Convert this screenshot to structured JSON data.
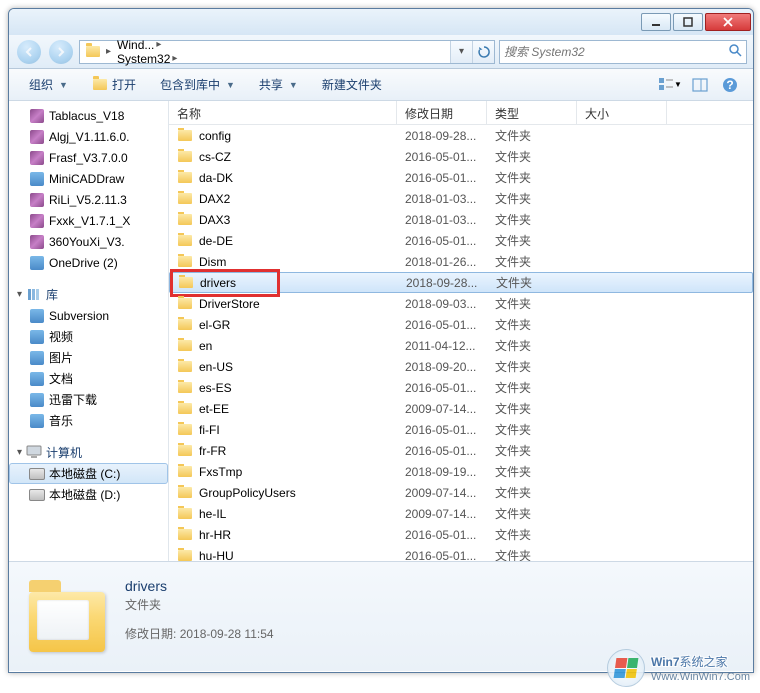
{
  "breadcrumb": {
    "items": [
      "Wind...",
      "System32"
    ]
  },
  "search": {
    "placeholder": "搜索 System32"
  },
  "toolbar": {
    "organize": "组织",
    "open": "打开",
    "include": "包含到库中",
    "share": "共享",
    "newfolder": "新建文件夹"
  },
  "columns": {
    "name": "名称",
    "date": "修改日期",
    "type": "类型",
    "size": "大小"
  },
  "tree": {
    "favorites": [
      {
        "label": "Tablacus_V18",
        "icon": "winrar"
      },
      {
        "label": "Algj_V1.11.6.0.",
        "icon": "winrar"
      },
      {
        "label": "Frasf_V3.7.0.0",
        "icon": "winrar"
      },
      {
        "label": "MiniCADDraw",
        "icon": "app"
      },
      {
        "label": "RiLi_V5.2.11.3",
        "icon": "winrar"
      },
      {
        "label": "Fxxk_V1.7.1_X",
        "icon": "winrar"
      },
      {
        "label": "360YouXi_V3.",
        "icon": "winrar"
      },
      {
        "label": "OneDrive (2)",
        "icon": "app"
      }
    ],
    "library_label": "库",
    "library": [
      {
        "label": "Subversion",
        "icon": "app"
      },
      {
        "label": "视频",
        "icon": "app"
      },
      {
        "label": "图片",
        "icon": "app"
      },
      {
        "label": "文档",
        "icon": "app"
      },
      {
        "label": "迅雷下载",
        "icon": "app"
      },
      {
        "label": "音乐",
        "icon": "app"
      }
    ],
    "computer_label": "计算机",
    "computer": [
      {
        "label": "本地磁盘 (C:)",
        "icon": "drive",
        "selected": true
      },
      {
        "label": "本地磁盘 (D:)",
        "icon": "drive"
      }
    ]
  },
  "files": [
    {
      "name": "config",
      "date": "2018-09-28...",
      "type": "文件夹"
    },
    {
      "name": "cs-CZ",
      "date": "2016-05-01...",
      "type": "文件夹"
    },
    {
      "name": "da-DK",
      "date": "2016-05-01...",
      "type": "文件夹"
    },
    {
      "name": "DAX2",
      "date": "2018-01-03...",
      "type": "文件夹"
    },
    {
      "name": "DAX3",
      "date": "2018-01-03...",
      "type": "文件夹"
    },
    {
      "name": "de-DE",
      "date": "2016-05-01...",
      "type": "文件夹"
    },
    {
      "name": "Dism",
      "date": "2018-01-26...",
      "type": "文件夹"
    },
    {
      "name": "drivers",
      "date": "2018-09-28...",
      "type": "文件夹",
      "selected": true,
      "redbox": true
    },
    {
      "name": "DriverStore",
      "date": "2018-09-03...",
      "type": "文件夹"
    },
    {
      "name": "el-GR",
      "date": "2016-05-01...",
      "type": "文件夹"
    },
    {
      "name": "en",
      "date": "2011-04-12...",
      "type": "文件夹"
    },
    {
      "name": "en-US",
      "date": "2018-09-20...",
      "type": "文件夹"
    },
    {
      "name": "es-ES",
      "date": "2016-05-01...",
      "type": "文件夹"
    },
    {
      "name": "et-EE",
      "date": "2009-07-14...",
      "type": "文件夹"
    },
    {
      "name": "fi-FI",
      "date": "2016-05-01...",
      "type": "文件夹"
    },
    {
      "name": "fr-FR",
      "date": "2016-05-01...",
      "type": "文件夹"
    },
    {
      "name": "FxsTmp",
      "date": "2018-09-19...",
      "type": "文件夹"
    },
    {
      "name": "GroupPolicyUsers",
      "date": "2009-07-14...",
      "type": "文件夹"
    },
    {
      "name": "he-IL",
      "date": "2009-07-14...",
      "type": "文件夹"
    },
    {
      "name": "hr-HR",
      "date": "2016-05-01...",
      "type": "文件夹"
    },
    {
      "name": "hu-HU",
      "date": "2016-05-01...",
      "type": "文件夹"
    }
  ],
  "details": {
    "name": "drivers",
    "type": "文件夹",
    "prop_label": "修改日期:",
    "prop_value": "2018-09-28 11:54"
  },
  "watermark": {
    "brand": "Win7",
    "title": "系统之家",
    "url": "Www.WinWin7.Com"
  }
}
